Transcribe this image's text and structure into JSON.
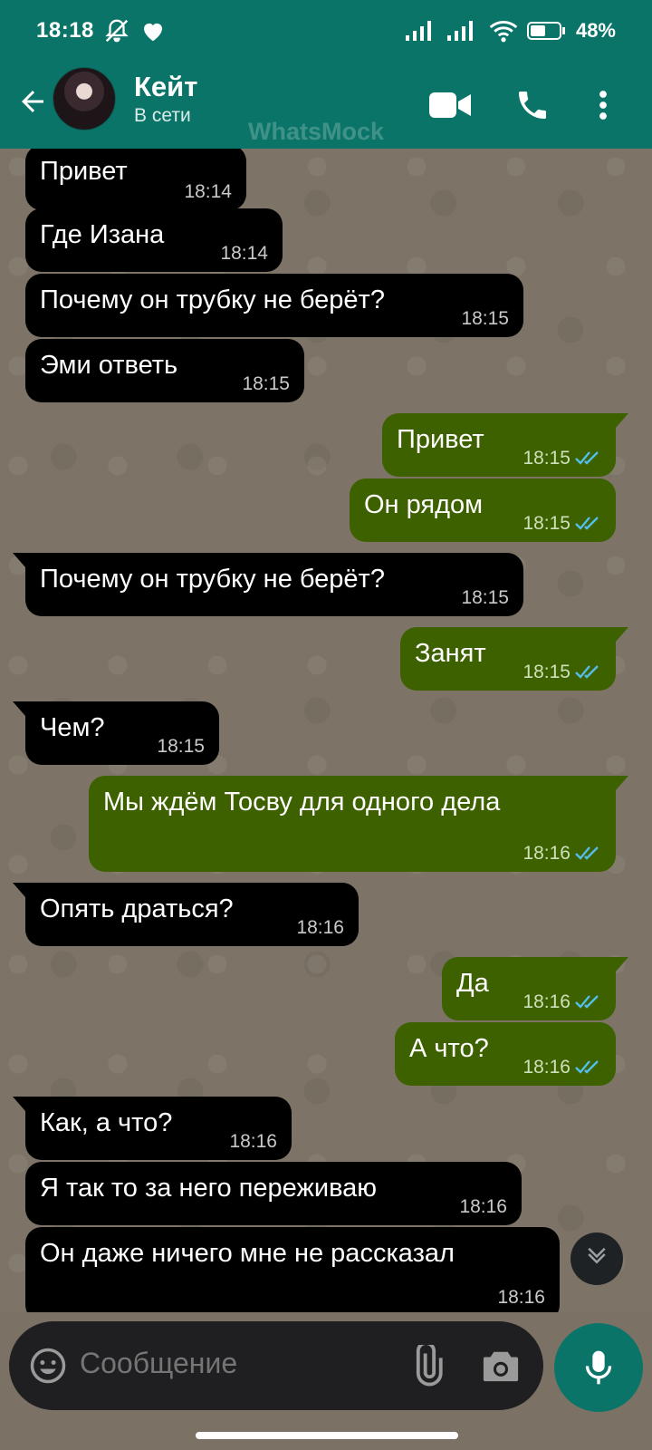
{
  "status_bar": {
    "time": "18:18",
    "battery": "48%"
  },
  "header": {
    "contact_name": "Кейт",
    "contact_status": "В сети",
    "watermark": "WhatsMock"
  },
  "messages": [
    {
      "dir": "in",
      "text": "Привет",
      "time": "18:14"
    },
    {
      "dir": "in",
      "text": "Где Изана",
      "time": "18:14"
    },
    {
      "dir": "in",
      "text": "Почему он трубку не берёт?",
      "time": "18:15"
    },
    {
      "dir": "in",
      "text": "Эми ответь",
      "time": "18:15"
    },
    {
      "dir": "out",
      "text": "Привет",
      "time": "18:15",
      "status": "read"
    },
    {
      "dir": "out",
      "text": "Он рядом",
      "time": "18:15",
      "status": "read"
    },
    {
      "dir": "in",
      "text": "Почему он трубку не берёт?",
      "time": "18:15"
    },
    {
      "dir": "out",
      "text": "Занят",
      "time": "18:15",
      "status": "read"
    },
    {
      "dir": "in",
      "text": "Чем?",
      "time": "18:15"
    },
    {
      "dir": "out",
      "text": "Мы ждём Тосву для одного дела",
      "time": "18:16",
      "status": "read"
    },
    {
      "dir": "in",
      "text": "Опять драться?",
      "time": "18:16"
    },
    {
      "dir": "out",
      "text": "Да",
      "time": "18:16",
      "status": "read"
    },
    {
      "dir": "out",
      "text": "А что?",
      "time": "18:16",
      "status": "read"
    },
    {
      "dir": "in",
      "text": "Как, а что?",
      "time": "18:16"
    },
    {
      "dir": "in",
      "text": "Я так то за него переживаю",
      "time": "18:16"
    },
    {
      "dir": "in",
      "text": "Он даже ничего мне не рассказал",
      "time": "18:16"
    }
  ],
  "input": {
    "placeholder": "Сообщение"
  },
  "colors": {
    "header": "#0b7468",
    "incoming_bubble": "#000000",
    "outgoing_bubble": "#3e6100",
    "read_ticks": "#53bdeb"
  },
  "icons": [
    "back-arrow-icon",
    "video-call-icon",
    "phone-call-icon",
    "more-vert-icon",
    "emoji-icon",
    "attach-icon",
    "camera-icon",
    "mic-icon",
    "chevron-down-icon"
  ]
}
